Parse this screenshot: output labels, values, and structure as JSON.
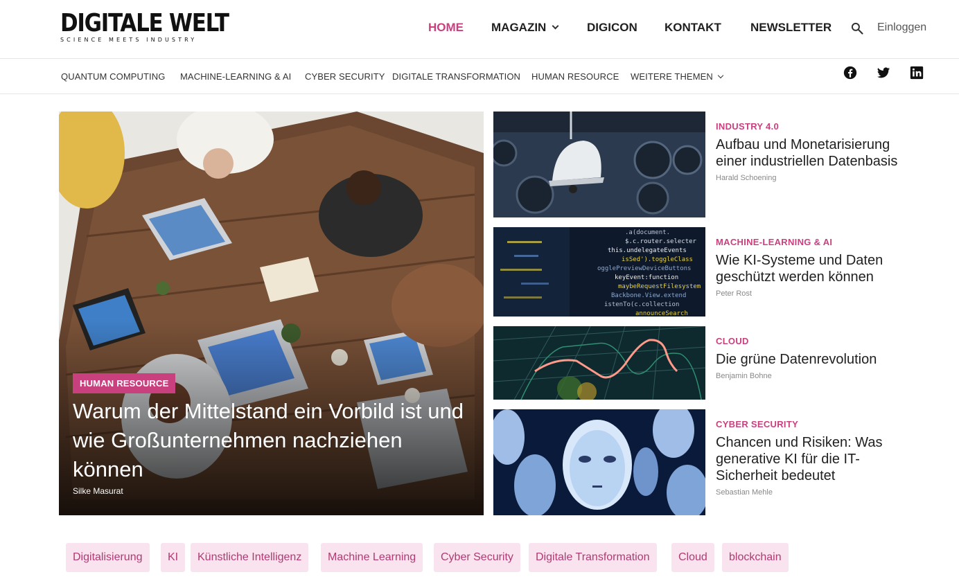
{
  "logo": {
    "name": "DIGITALE WELT",
    "tagline": "SCIENCE MEETS INDUSTRY"
  },
  "main_nav": [
    {
      "label": "HOME",
      "active": true
    },
    {
      "label": "MAGAZIN",
      "has_dropdown": true
    },
    {
      "label": "DIGICON"
    },
    {
      "label": "KONTAKT"
    },
    {
      "label": "NEWSLETTER"
    }
  ],
  "search_icon": "search-icon",
  "login_label": "Einloggen",
  "sub_nav": [
    "QUANTUM COMPUTING",
    "MACHINE-LEARNING & AI",
    "CYBER SECURITY",
    "DIGITALE TRANSFORMATION",
    "HUMAN RESOURCE",
    "WEITERE THEMEN"
  ],
  "social": [
    "facebook-icon",
    "twitter-icon",
    "linkedin-icon"
  ],
  "hero": {
    "category": "HUMAN RESOURCE",
    "title": "Warum der Mittelstand ein Vorbild ist und wie Großunternehmen nachziehen können",
    "author": "Silke Masurat"
  },
  "side_articles": [
    {
      "category": "INDUSTRY 4.0",
      "title": "Aufbau und Monetarisierung einer industriellen Datenbasis",
      "author": "Harald Schoening"
    },
    {
      "category": "MACHINE-LEARNING & AI",
      "title": "Wie KI-Systeme und Daten geschützt werden können",
      "author": "Peter Rost"
    },
    {
      "category": "CLOUD",
      "title": "Die grüne Datenrevolution",
      "author": "Benjamin Bohne"
    },
    {
      "category": "CYBER SECURITY",
      "title": "Chancen und Risiken: Was generative KI für die IT-Sicherheit bedeutet",
      "author": "Sebastian Mehle"
    }
  ],
  "code_lines": [
    ".a(document.",
    "$.c.router.selecter",
    "this.undelegateEvents",
    "isSed').toggleClass",
    "ogglePreviewDeviceButtons",
    "keyEvent:function",
    "maybeRequestFilesystem",
    "Backbone.View.extend",
    "istenTo(c.collection",
    "announceSearch"
  ],
  "tags": [
    "Digitalisierung",
    "KI",
    "Künstliche Intelligenz",
    "Machine Learning",
    "Cyber Security",
    "Digitale Transformation",
    "Cloud",
    "blockchain"
  ],
  "colors": {
    "accent": "#c9407f",
    "tag_bg": "#f8e3ee",
    "tag_text": "#b03a73"
  }
}
